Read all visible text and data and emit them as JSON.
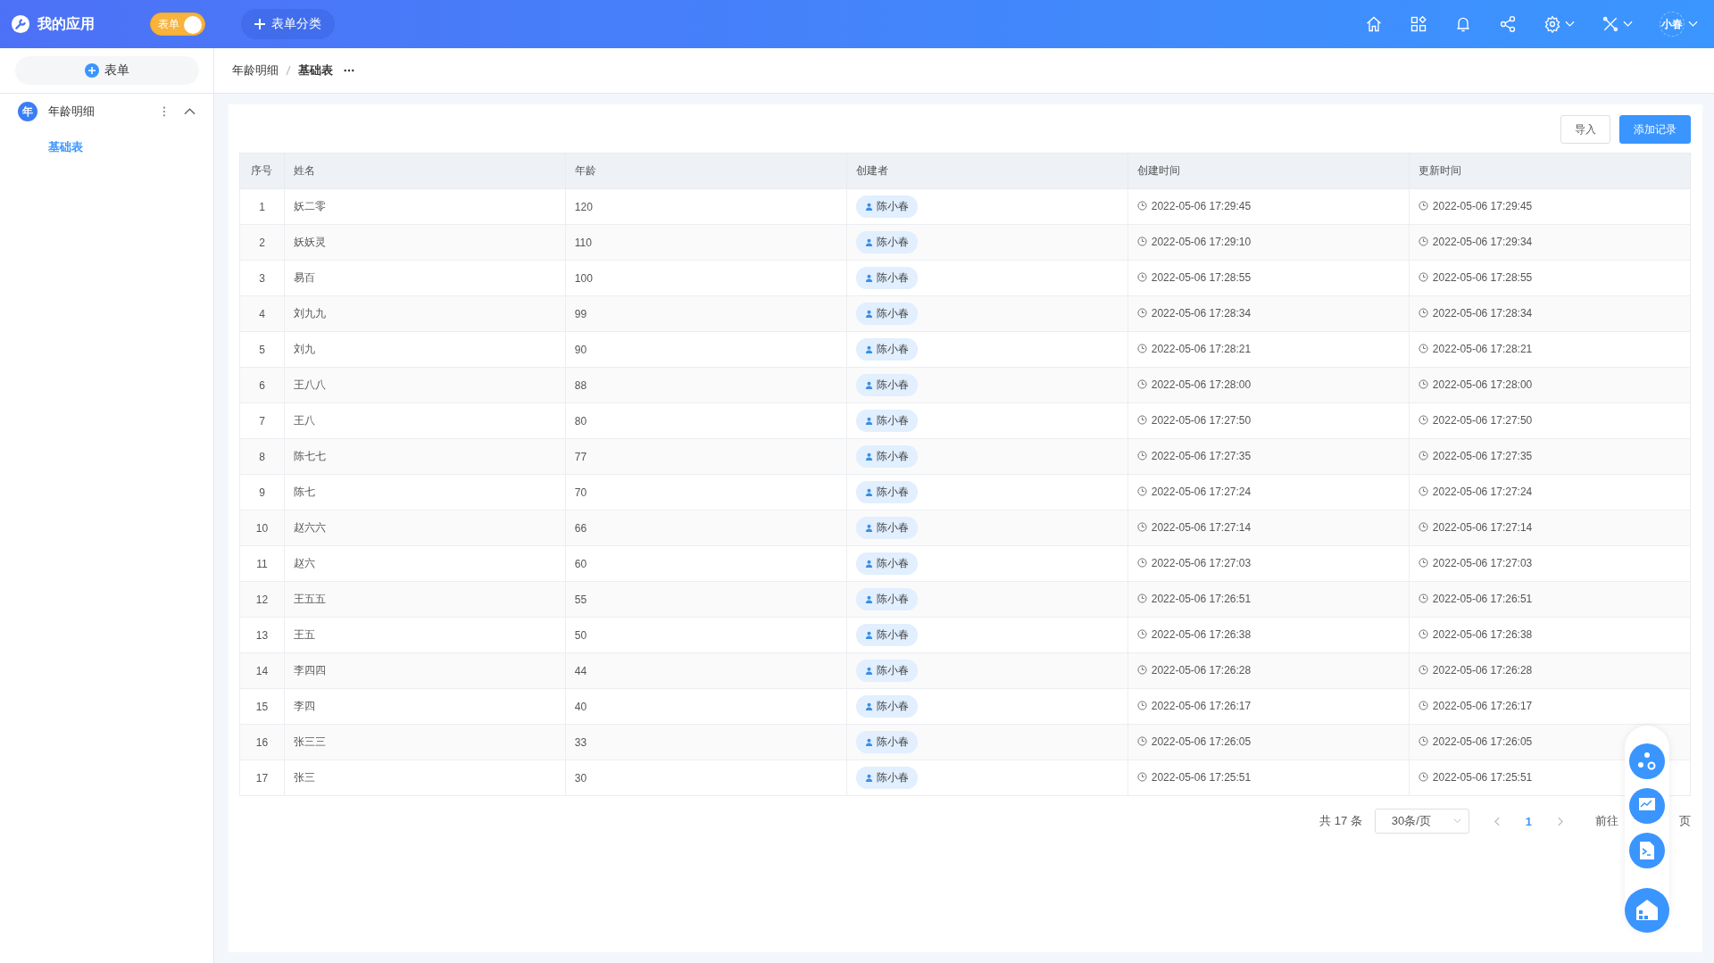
{
  "header": {
    "app_title": "我的应用",
    "switch": {
      "label": "表单",
      "on": true
    },
    "category_button": "表单分类",
    "user": "小春"
  },
  "sidebar": {
    "add_button": "表单",
    "groups": [
      {
        "avatar": "年",
        "label": "年龄明细",
        "expanded": true,
        "children": [
          {
            "label": "基础表",
            "selected": true
          }
        ]
      }
    ]
  },
  "breadcrumb": [
    "年龄明细",
    "基础表"
  ],
  "toolbar": {
    "buttons": [
      {
        "label": "导入",
        "kind": "plain"
      },
      {
        "label": "添加记录",
        "kind": "primary"
      }
    ]
  },
  "table": {
    "columns": [
      "序号",
      "姓名",
      "年龄",
      "创建者",
      "创建时间",
      "更新时间"
    ],
    "rows": [
      {
        "index": "1",
        "name": "妖二零",
        "age": "120",
        "creator": "陈小春",
        "created": "2022-05-06 17:29:45",
        "updated": "2022-05-06 17:29:45"
      },
      {
        "index": "2",
        "name": "妖妖灵",
        "age": "110",
        "creator": "陈小春",
        "created": "2022-05-06 17:29:10",
        "updated": "2022-05-06 17:29:34"
      },
      {
        "index": "3",
        "name": "易百",
        "age": "100",
        "creator": "陈小春",
        "created": "2022-05-06 17:28:55",
        "updated": "2022-05-06 17:28:55"
      },
      {
        "index": "4",
        "name": "刘九九",
        "age": "99",
        "creator": "陈小春",
        "created": "2022-05-06 17:28:34",
        "updated": "2022-05-06 17:28:34"
      },
      {
        "index": "5",
        "name": "刘九",
        "age": "90",
        "creator": "陈小春",
        "created": "2022-05-06 17:28:21",
        "updated": "2022-05-06 17:28:21"
      },
      {
        "index": "6",
        "name": "王八八",
        "age": "88",
        "creator": "陈小春",
        "created": "2022-05-06 17:28:00",
        "updated": "2022-05-06 17:28:00"
      },
      {
        "index": "7",
        "name": "王八",
        "age": "80",
        "creator": "陈小春",
        "created": "2022-05-06 17:27:50",
        "updated": "2022-05-06 17:27:50"
      },
      {
        "index": "8",
        "name": "陈七七",
        "age": "77",
        "creator": "陈小春",
        "created": "2022-05-06 17:27:35",
        "updated": "2022-05-06 17:27:35"
      },
      {
        "index": "9",
        "name": "陈七",
        "age": "70",
        "creator": "陈小春",
        "created": "2022-05-06 17:27:24",
        "updated": "2022-05-06 17:27:24"
      },
      {
        "index": "10",
        "name": "赵六六",
        "age": "66",
        "creator": "陈小春",
        "created": "2022-05-06 17:27:14",
        "updated": "2022-05-06 17:27:14"
      },
      {
        "index": "11",
        "name": "赵六",
        "age": "60",
        "creator": "陈小春",
        "created": "2022-05-06 17:27:03",
        "updated": "2022-05-06 17:27:03"
      },
      {
        "index": "12",
        "name": "王五五",
        "age": "55",
        "creator": "陈小春",
        "created": "2022-05-06 17:26:51",
        "updated": "2022-05-06 17:26:51"
      },
      {
        "index": "13",
        "name": "王五",
        "age": "50",
        "creator": "陈小春",
        "created": "2022-05-06 17:26:38",
        "updated": "2022-05-06 17:26:38"
      },
      {
        "index": "14",
        "name": "李四四",
        "age": "44",
        "creator": "陈小春",
        "created": "2022-05-06 17:26:28",
        "updated": "2022-05-06 17:26:28"
      },
      {
        "index": "15",
        "name": "李四",
        "age": "40",
        "creator": "陈小春",
        "created": "2022-05-06 17:26:17",
        "updated": "2022-05-06 17:26:17"
      },
      {
        "index": "16",
        "name": "张三三",
        "age": "33",
        "creator": "陈小春",
        "created": "2022-05-06 17:26:05",
        "updated": "2022-05-06 17:26:05"
      },
      {
        "index": "17",
        "name": "张三",
        "age": "30",
        "creator": "陈小春",
        "created": "2022-05-06 17:25:51",
        "updated": "2022-05-06 17:25:51"
      }
    ]
  },
  "pagination": {
    "total": "共 17 条",
    "page_size": "30条/页",
    "pages": [
      {
        "label": "1",
        "selected": true
      }
    ],
    "goto_label": "前往",
    "page_suffix": "页"
  }
}
